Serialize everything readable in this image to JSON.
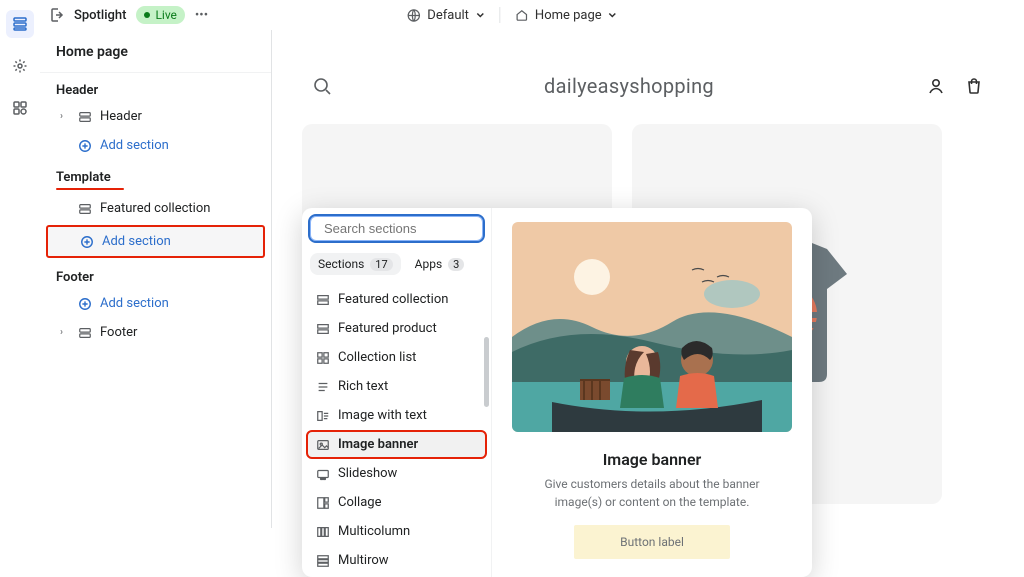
{
  "topbar": {
    "theme_name": "Spotlight",
    "live_label": "Live",
    "device_label": "Default",
    "page_label": "Home page"
  },
  "sidebar": {
    "title": "Home page",
    "groups": {
      "header": {
        "label": "Header",
        "items": [
          {
            "label": "Header"
          }
        ],
        "add_label": "Add section"
      },
      "template": {
        "label": "Template",
        "items": [
          {
            "label": "Featured collection"
          }
        ],
        "add_label": "Add section"
      },
      "footer": {
        "label": "Footer",
        "add_label": "Add section",
        "items": [
          {
            "label": "Footer"
          }
        ]
      }
    }
  },
  "popup": {
    "search_placeholder": "Search sections",
    "tabs": {
      "sections": {
        "label": "Sections",
        "count": "17"
      },
      "apps": {
        "label": "Apps",
        "count": "3"
      }
    },
    "sections": [
      "Featured collection",
      "Featured product",
      "Collection list",
      "Rich text",
      "Image with text",
      "Image banner",
      "Slideshow",
      "Collage",
      "Multicolumn",
      "Multirow"
    ],
    "preview": {
      "title": "Image banner",
      "desc": "Give customers details about the banner image(s) or content on the template.",
      "button": "Button label"
    }
  },
  "store": {
    "name": "dailyeasyshopping"
  }
}
